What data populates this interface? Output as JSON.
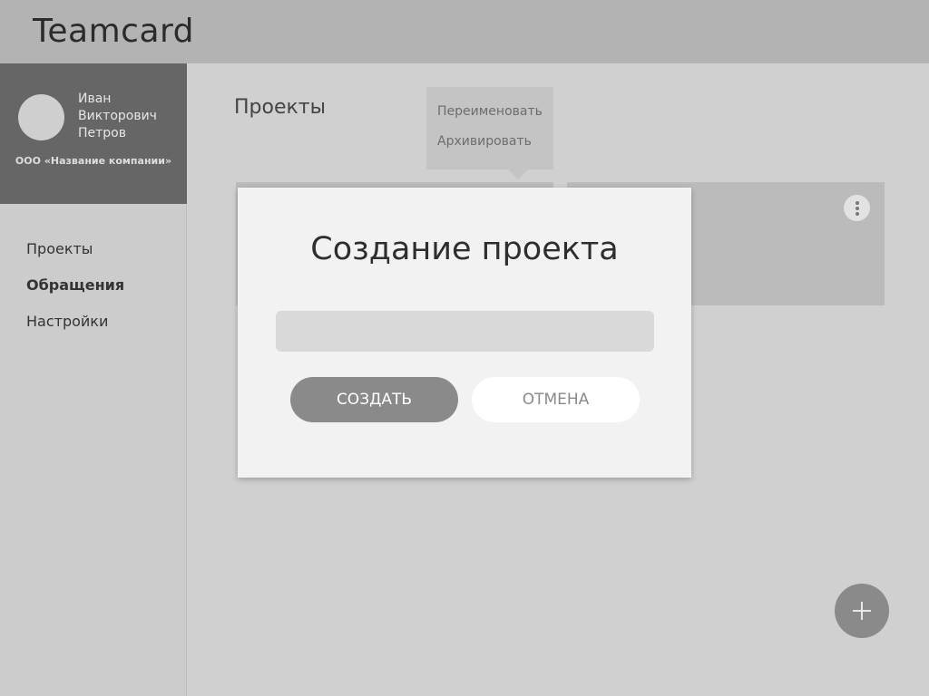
{
  "app": {
    "title": "Teamcard"
  },
  "user": {
    "name_lines": [
      "Иван",
      "Викторович",
      "Петров"
    ],
    "company": "ООО «Название компании»"
  },
  "sidebar": {
    "items": [
      {
        "label": "Проекты",
        "active": false
      },
      {
        "label": "Обращения",
        "active": true
      },
      {
        "label": "Настройки",
        "active": false
      }
    ]
  },
  "main": {
    "title": "Проекты",
    "context_menu": {
      "rename": "Переименовать",
      "archive": "Архивировать"
    }
  },
  "modal": {
    "title": "Создание проекта",
    "input_value": "",
    "create_label": "СОЗДАТЬ",
    "cancel_label": "ОТМЕНА"
  },
  "icons": {
    "more": "more-vertical-icon",
    "add": "plus-icon"
  }
}
